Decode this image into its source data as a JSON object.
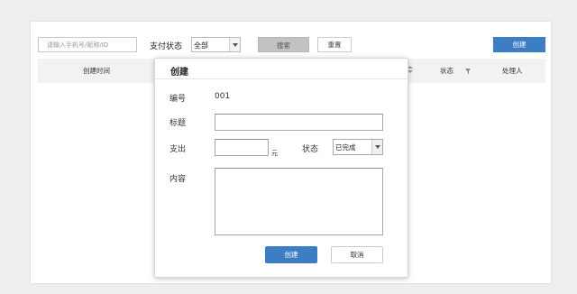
{
  "toolbar": {
    "search_placeholder": "请输入手机号/昵称/ID",
    "pay_status_label": "支付状态",
    "pay_status_value": "全部",
    "search_label": "搜索",
    "reset_label": "重置",
    "create_label": "创建"
  },
  "table": {
    "headers": {
      "created_time": "创建时间",
      "status": "状态",
      "handler": "处理人"
    }
  },
  "modal": {
    "title": "创建",
    "fields": {
      "number_label": "编号",
      "number_value": "001",
      "title_label": "标题",
      "title_value": "",
      "expense_label": "支出",
      "expense_value": "",
      "expense_unit": "元",
      "status_label": "状态",
      "status_value": "已完成",
      "content_label": "内容",
      "content_value": ""
    },
    "confirm_label": "创建",
    "cancel_label": "取消"
  },
  "colors": {
    "primary": "#3d7dc4",
    "search_button": "#c2c2c2"
  }
}
